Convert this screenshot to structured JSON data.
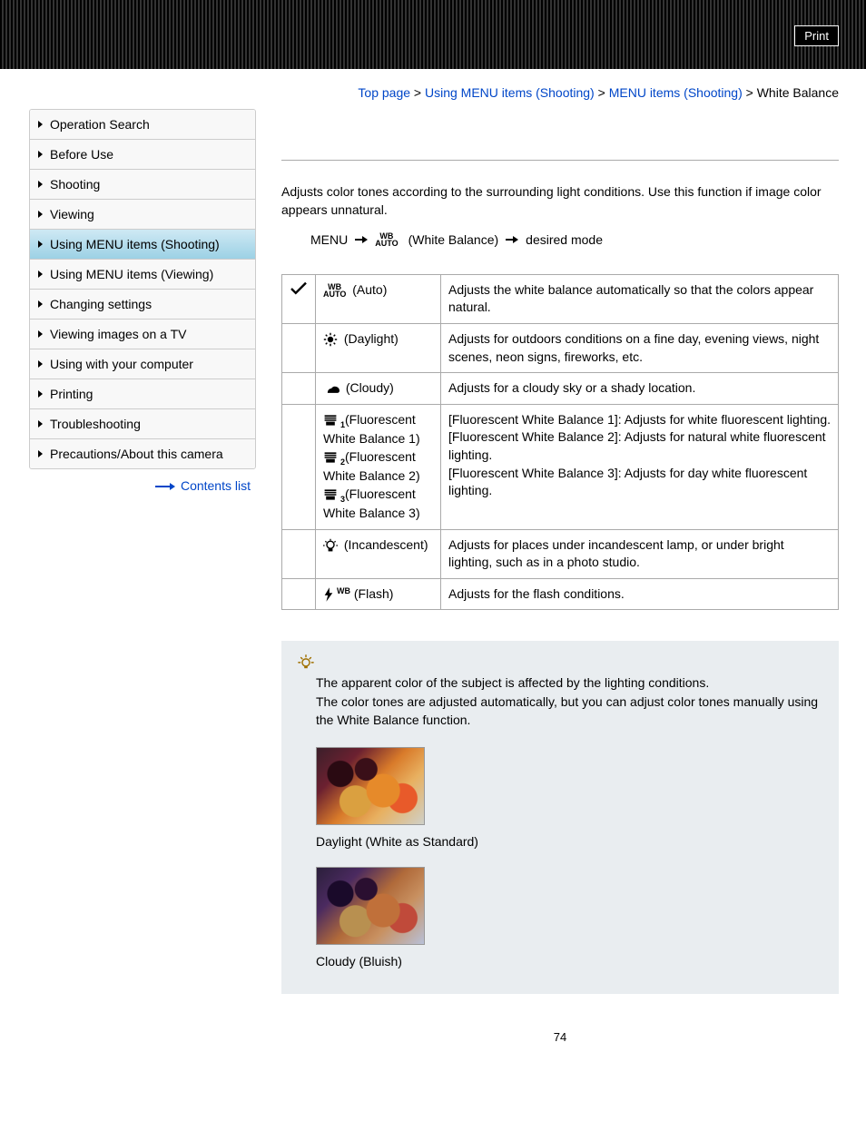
{
  "header": {
    "print": "Print"
  },
  "breadcrumb": {
    "top": "Top page",
    "l1": "Using MENU items (Shooting)",
    "l2": "MENU items (Shooting)",
    "current": "White Balance",
    "sep": " > "
  },
  "sidebar": {
    "items": [
      "Operation Search",
      "Before Use",
      "Shooting",
      "Viewing",
      "Using MENU items (Shooting)",
      "Using MENU items (Viewing)",
      "Changing settings",
      "Viewing images on a TV",
      "Using with your computer",
      "Printing",
      "Troubleshooting",
      "Precautions/About this camera"
    ],
    "active_index": 4,
    "contents_list": "Contents list"
  },
  "main": {
    "intro": "Adjusts color tones according to the surrounding light conditions. Use this function if image color appears unnatural.",
    "menu_path": {
      "menu": "MENU",
      "wb": "(White Balance)",
      "desired": "desired mode"
    },
    "modes": [
      {
        "checked": true,
        "name": "(Auto)",
        "desc": "Adjusts the white balance automatically so that the colors appear natural."
      },
      {
        "checked": false,
        "name": "(Daylight)",
        "desc": "Adjusts for outdoors conditions on a fine day, evening views, night scenes, neon signs, fireworks, etc."
      },
      {
        "checked": false,
        "name": "(Cloudy)",
        "desc": "Adjusts for a cloudy sky or a shady location."
      },
      {
        "checked": false,
        "name_lines": [
          "(Fluorescent White Balance 1)",
          "(Fluorescent White Balance 2)",
          "(Fluorescent White Balance 3)"
        ],
        "desc": "[Fluorescent White Balance 1]: Adjusts for white fluorescent lighting.\n[Fluorescent White Balance 2]: Adjusts for natural white fluorescent lighting.\n[Fluorescent White Balance 3]: Adjusts for day white fluorescent lighting."
      },
      {
        "checked": false,
        "name": "(Incandescent)",
        "desc": "Adjusts for places under incandescent lamp, or under bright lighting, such as in a photo studio."
      },
      {
        "checked": false,
        "name": "(Flash)",
        "desc": "Adjusts for the flash conditions."
      }
    ],
    "tip": {
      "p1": "The apparent color of the subject is affected by the lighting conditions.",
      "p2": "The color tones are adjusted automatically, but you can adjust color tones manually using the White Balance function.",
      "cap1": "Daylight (White as Standard)",
      "cap2": "Cloudy (Bluish)"
    },
    "page_num": "74"
  }
}
